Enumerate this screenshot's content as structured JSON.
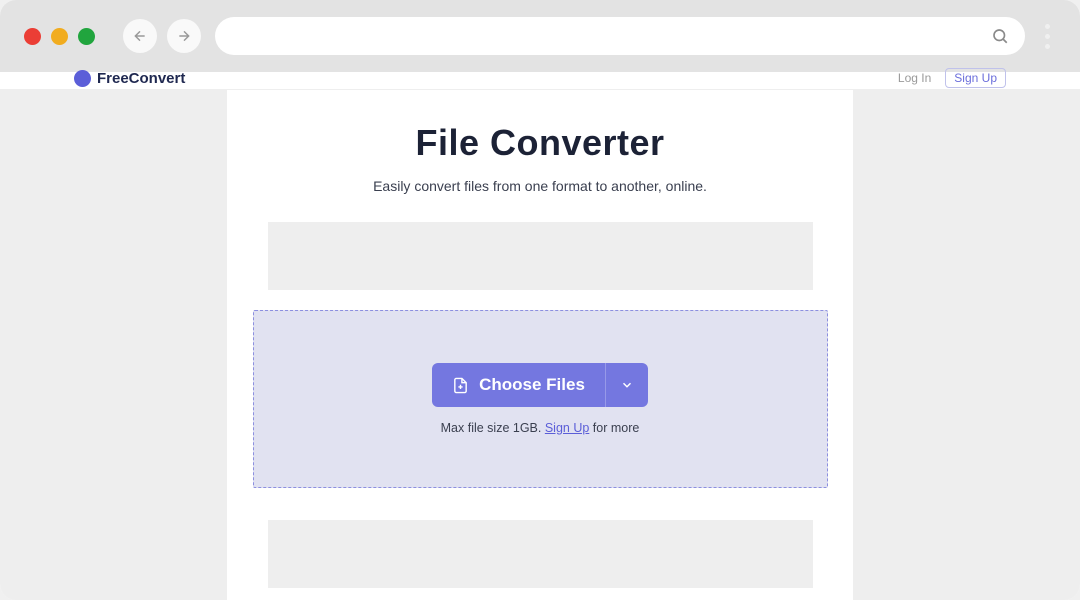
{
  "header": {
    "logo_text": "FreeConvert",
    "login": "Log In",
    "signup": "Sign Up"
  },
  "main": {
    "title": "File Converter",
    "subtitle": "Easily convert files from one format to another, online.",
    "choose_files_label": "Choose Files",
    "max_prefix": "Max file size 1GB. ",
    "signup_link": "Sign Up",
    "max_suffix": " for more"
  }
}
